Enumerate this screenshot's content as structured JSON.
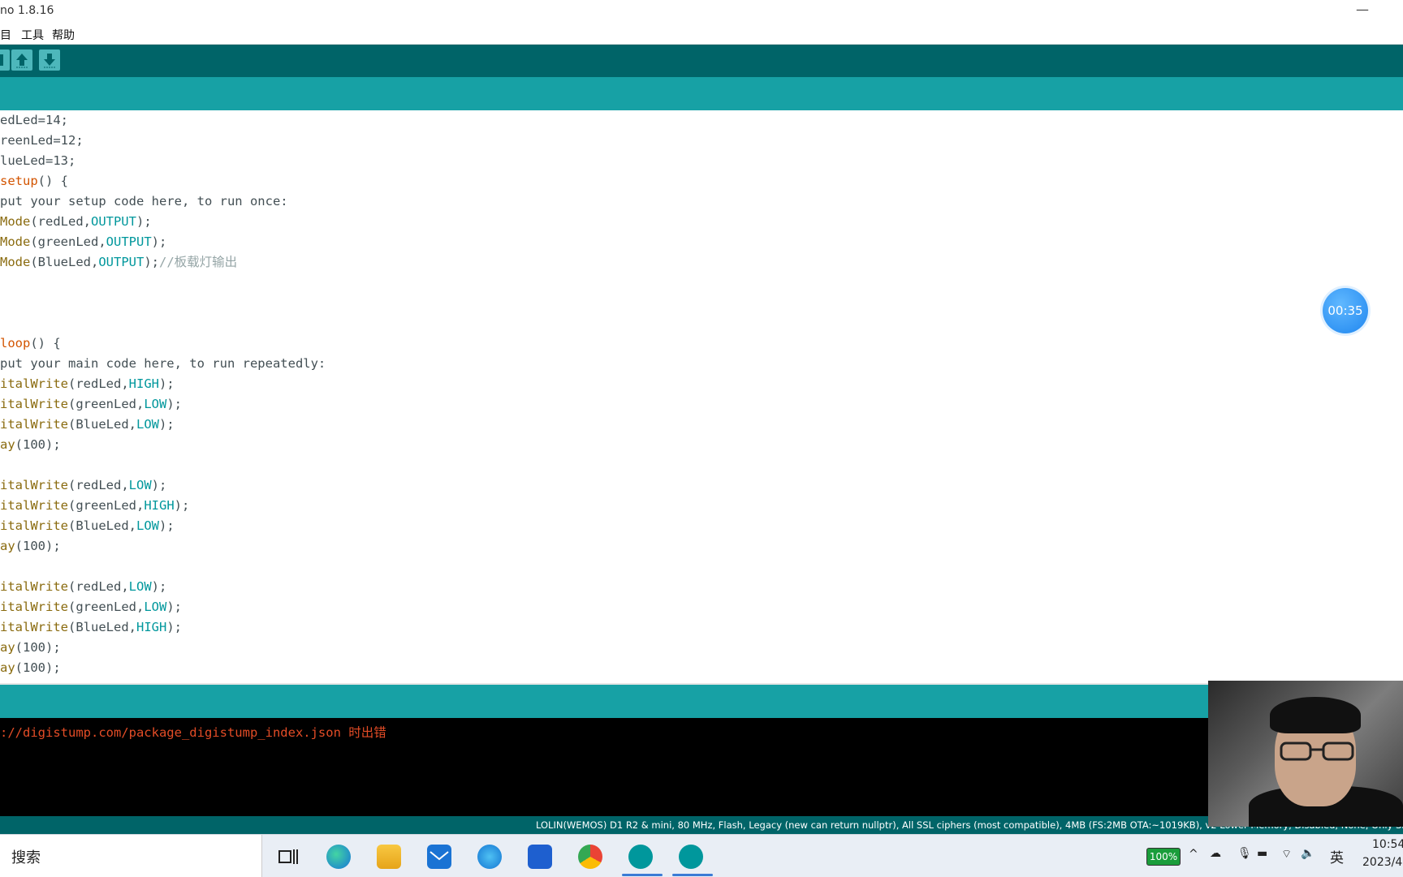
{
  "window": {
    "title": "no 1.8.16",
    "minimize": "—"
  },
  "menu": [
    {
      "label": "目",
      "x": 0
    },
    {
      "label": "工具",
      "x": 26
    },
    {
      "label": "帮助",
      "x": 64
    }
  ],
  "code": [
    [
      [
        "t",
        "edLed=14;"
      ]
    ],
    [
      [
        "t",
        "reenLed=12;"
      ]
    ],
    [
      [
        "t",
        "lueLed=13;"
      ]
    ],
    [
      [
        "o",
        "setup"
      ],
      [
        "t",
        "() {"
      ]
    ],
    [
      [
        "t",
        "put your setup code here, to run once:"
      ]
    ],
    [
      [
        "f",
        "Mode"
      ],
      [
        "t",
        "(redLed,"
      ],
      [
        "c",
        "OUTPUT"
      ],
      [
        "t",
        ");"
      ]
    ],
    [
      [
        "f",
        "Mode"
      ],
      [
        "t",
        "(greenLed,"
      ],
      [
        "c",
        "OUTPUT"
      ],
      [
        "t",
        ");"
      ]
    ],
    [
      [
        "f",
        "Mode"
      ],
      [
        "t",
        "(BlueLed,"
      ],
      [
        "c",
        "OUTPUT"
      ],
      [
        "t",
        ");"
      ],
      [
        "m",
        "//板载灯输出"
      ]
    ],
    [],
    [],
    [],
    [
      [
        "o",
        "loop"
      ],
      [
        "t",
        "() {"
      ]
    ],
    [
      [
        "t",
        "put your main code here, to run repeatedly:"
      ]
    ],
    [
      [
        "f",
        "italWrite"
      ],
      [
        "t",
        "(redLed,"
      ],
      [
        "c",
        "HIGH"
      ],
      [
        "t",
        ");"
      ]
    ],
    [
      [
        "f",
        "italWrite"
      ],
      [
        "t",
        "(greenLed,"
      ],
      [
        "c",
        "LOW"
      ],
      [
        "t",
        ");"
      ]
    ],
    [
      [
        "f",
        "italWrite"
      ],
      [
        "t",
        "(BlueLed,"
      ],
      [
        "c",
        "LOW"
      ],
      [
        "t",
        ");"
      ]
    ],
    [
      [
        "f",
        "ay"
      ],
      [
        "t",
        "(100);"
      ]
    ],
    [],
    [
      [
        "f",
        "italWrite"
      ],
      [
        "t",
        "(redLed,"
      ],
      [
        "c",
        "LOW"
      ],
      [
        "t",
        ");"
      ]
    ],
    [
      [
        "f",
        "italWrite"
      ],
      [
        "t",
        "(greenLed,"
      ],
      [
        "c",
        "HIGH"
      ],
      [
        "t",
        ");"
      ]
    ],
    [
      [
        "f",
        "italWrite"
      ],
      [
        "t",
        "(BlueLed,"
      ],
      [
        "c",
        "LOW"
      ],
      [
        "t",
        ");"
      ]
    ],
    [
      [
        "f",
        "ay"
      ],
      [
        "t",
        "(100);"
      ]
    ],
    [],
    [
      [
        "f",
        "italWrite"
      ],
      [
        "t",
        "(redLed,"
      ],
      [
        "c",
        "LOW"
      ],
      [
        "t",
        ");"
      ]
    ],
    [
      [
        "f",
        "italWrite"
      ],
      [
        "t",
        "(greenLed,"
      ],
      [
        "c",
        "LOW"
      ],
      [
        "t",
        ");"
      ]
    ],
    [
      [
        "f",
        "italWrite"
      ],
      [
        "t",
        "(BlueLed,"
      ],
      [
        "c",
        "HIGH"
      ],
      [
        "t",
        ");"
      ]
    ],
    [
      [
        "f",
        "ay"
      ],
      [
        "t",
        "(100);"
      ]
    ],
    [
      [
        "f",
        "ay"
      ],
      [
        "t",
        "(100);"
      ]
    ]
  ],
  "timer": "00:35",
  "console": {
    "message": "://digistump.com/package_digistump_index.json 时出错"
  },
  "status": {
    "board": "LOLIN(WEMOS) D1 R2 & mini, 80 MHz, Flash, Legacy (new can return nullptr), All SSL ciphers (most compatible), 4MB (FS:2MB OTA:~1019KB), v2 Lower Memory, Disabled, None, Only Sketch, 921600"
  },
  "taskbar": {
    "search_label": "搜索",
    "battery": "100%",
    "ime": "英",
    "time": "10:54",
    "date": "2023/4"
  },
  "colors": {
    "toolbar": "#006468",
    "tabbar": "#17a1a5",
    "console_text": "#e34c26"
  }
}
